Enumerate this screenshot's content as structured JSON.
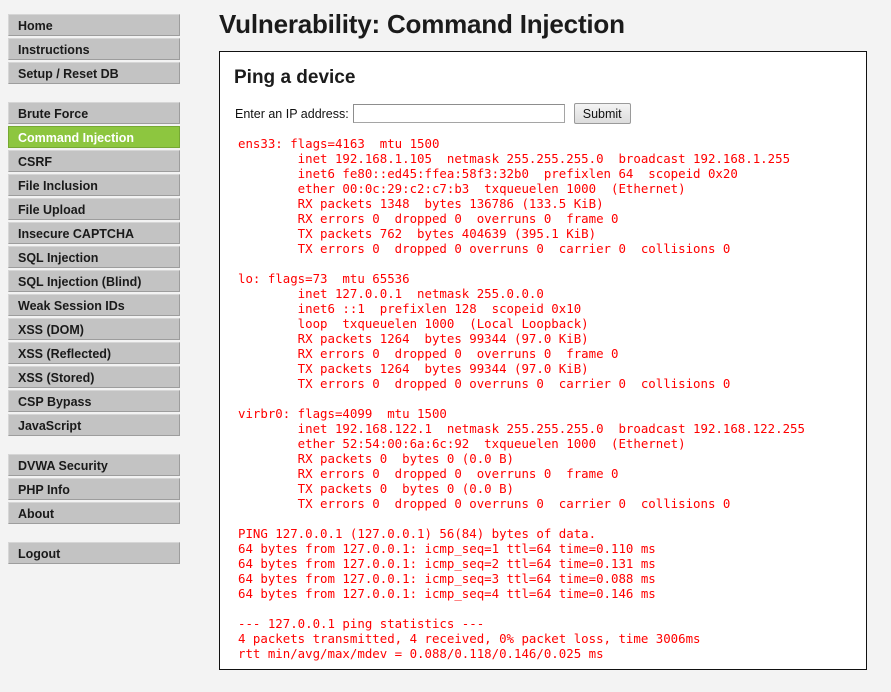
{
  "page": {
    "title": "Vulnerability: Command Injection",
    "accent_green": "#8dc63f",
    "output_red": "#ff0000",
    "sidebar_button_bg": "#c3c3c3",
    "background": "#f3f3f3"
  },
  "sidebar": {
    "groups": [
      {
        "name": "primary",
        "items": [
          {
            "label": "Home",
            "selected": false
          },
          {
            "label": "Instructions",
            "selected": false
          },
          {
            "label": "Setup / Reset DB",
            "selected": false
          }
        ]
      },
      {
        "name": "vulnerabilities",
        "items": [
          {
            "label": "Brute Force",
            "selected": false
          },
          {
            "label": "Command Injection",
            "selected": true
          },
          {
            "label": "CSRF",
            "selected": false
          },
          {
            "label": "File Inclusion",
            "selected": false
          },
          {
            "label": "File Upload",
            "selected": false
          },
          {
            "label": "Insecure CAPTCHA",
            "selected": false
          },
          {
            "label": "SQL Injection",
            "selected": false
          },
          {
            "label": "SQL Injection (Blind)",
            "selected": false
          },
          {
            "label": "Weak Session IDs",
            "selected": false
          },
          {
            "label": "XSS (DOM)",
            "selected": false
          },
          {
            "label": "XSS (Reflected)",
            "selected": false
          },
          {
            "label": "XSS (Stored)",
            "selected": false
          },
          {
            "label": "CSP Bypass",
            "selected": false
          },
          {
            "label": "JavaScript",
            "selected": false
          }
        ]
      },
      {
        "name": "meta",
        "items": [
          {
            "label": "DVWA Security",
            "selected": false
          },
          {
            "label": "PHP Info",
            "selected": false
          },
          {
            "label": "About",
            "selected": false
          }
        ]
      },
      {
        "name": "session",
        "items": [
          {
            "label": "Logout",
            "selected": false
          }
        ]
      }
    ]
  },
  "panel": {
    "title": "Ping a device",
    "form": {
      "label": "Enter an IP address:",
      "input_value": "",
      "input_placeholder": "",
      "submit_label": "Submit"
    },
    "output": "ens33: flags=4163  mtu 1500\n        inet 192.168.1.105  netmask 255.255.255.0  broadcast 192.168.1.255\n        inet6 fe80::ed45:ffea:58f3:32b0  prefixlen 64  scopeid 0x20\n        ether 00:0c:29:c2:c7:b3  txqueuelen 1000  (Ethernet)\n        RX packets 1348  bytes 136786 (133.5 KiB)\n        RX errors 0  dropped 0  overruns 0  frame 0\n        TX packets 762  bytes 404639 (395.1 KiB)\n        TX errors 0  dropped 0 overruns 0  carrier 0  collisions 0\n\nlo: flags=73  mtu 65536\n        inet 127.0.0.1  netmask 255.0.0.0\n        inet6 ::1  prefixlen 128  scopeid 0x10\n        loop  txqueuelen 1000  (Local Loopback)\n        RX packets 1264  bytes 99344 (97.0 KiB)\n        RX errors 0  dropped 0  overruns 0  frame 0\n        TX packets 1264  bytes 99344 (97.0 KiB)\n        TX errors 0  dropped 0 overruns 0  carrier 0  collisions 0\n\nvirbr0: flags=4099  mtu 1500\n        inet 192.168.122.1  netmask 255.255.255.0  broadcast 192.168.122.255\n        ether 52:54:00:6a:6c:92  txqueuelen 1000  (Ethernet)\n        RX packets 0  bytes 0 (0.0 B)\n        RX errors 0  dropped 0  overruns 0  frame 0\n        TX packets 0  bytes 0 (0.0 B)\n        TX errors 0  dropped 0 overruns 0  carrier 0  collisions 0\n\nPING 127.0.0.1 (127.0.0.1) 56(84) bytes of data.\n64 bytes from 127.0.0.1: icmp_seq=1 ttl=64 time=0.110 ms\n64 bytes from 127.0.0.1: icmp_seq=2 ttl=64 time=0.131 ms\n64 bytes from 127.0.0.1: icmp_seq=3 ttl=64 time=0.088 ms\n64 bytes from 127.0.0.1: icmp_seq=4 ttl=64 time=0.146 ms\n\n--- 127.0.0.1 ping statistics ---\n4 packets transmitted, 4 received, 0% packet loss, time 3006ms\nrtt min/avg/max/mdev = 0.088/0.118/0.146/0.025 ms",
    "output_details": {
      "interfaces": [
        {
          "name": "ens33",
          "flags": "4163",
          "mtu": "1500",
          "inet": "192.168.1.105",
          "netmask": "255.255.255.0",
          "broadcast": "192.168.1.255",
          "inet6": "fe80::ed45:ffea:58f3:32b0",
          "prefixlen": "64",
          "scopeid": "0x20",
          "ether": "00:0c:29:c2:c7:b3",
          "txqueuelen": "1000",
          "type": "Ethernet",
          "rx_packets": "1348",
          "rx_bytes": "136786 (133.5 KiB)",
          "rx_errors": "0",
          "rx_dropped": "0",
          "rx_overruns": "0",
          "rx_frame": "0",
          "tx_packets": "762",
          "tx_bytes": "404639 (395.1 KiB)",
          "tx_errors": "0",
          "tx_dropped": "0",
          "tx_overruns": "0",
          "tx_carrier": "0",
          "tx_collisions": "0"
        },
        {
          "name": "lo",
          "flags": "73",
          "mtu": "65536",
          "inet": "127.0.0.1",
          "netmask": "255.0.0.0",
          "inet6": "::1",
          "prefixlen": "128",
          "scopeid": "0x10",
          "txqueuelen": "1000",
          "type": "Local Loopback",
          "rx_packets": "1264",
          "rx_bytes": "99344 (97.0 KiB)",
          "rx_errors": "0",
          "rx_dropped": "0",
          "rx_overruns": "0",
          "rx_frame": "0",
          "tx_packets": "1264",
          "tx_bytes": "99344 (97.0 KiB)",
          "tx_errors": "0",
          "tx_dropped": "0",
          "tx_overruns": "0",
          "tx_carrier": "0",
          "tx_collisions": "0"
        },
        {
          "name": "virbr0",
          "flags": "4099",
          "mtu": "1500",
          "inet": "192.168.122.1",
          "netmask": "255.255.255.0",
          "broadcast": "192.168.122.255",
          "ether": "52:54:00:6a:6c:92",
          "txqueuelen": "1000",
          "type": "Ethernet",
          "rx_packets": "0",
          "rx_bytes": "0 (0.0 B)",
          "rx_errors": "0",
          "rx_dropped": "0",
          "rx_overruns": "0",
          "rx_frame": "0",
          "tx_packets": "0",
          "tx_bytes": "0 (0.0 B)",
          "tx_errors": "0",
          "tx_dropped": "0",
          "tx_overruns": "0",
          "tx_carrier": "0",
          "tx_collisions": "0"
        }
      ],
      "ping": {
        "header": "PING 127.0.0.1 (127.0.0.1) 56(84) bytes of data.",
        "replies": [
          {
            "bytes": "64",
            "from": "127.0.0.1",
            "icmp_seq": "1",
            "ttl": "64",
            "time": "0.110 ms"
          },
          {
            "bytes": "64",
            "from": "127.0.0.1",
            "icmp_seq": "2",
            "ttl": "64",
            "time": "0.131 ms"
          },
          {
            "bytes": "64",
            "from": "127.0.0.1",
            "icmp_seq": "3",
            "ttl": "64",
            "time": "0.088 ms"
          },
          {
            "bytes": "64",
            "from": "127.0.0.1",
            "icmp_seq": "4",
            "ttl": "64",
            "time": "0.146 ms"
          }
        ],
        "statistics_header": "--- 127.0.0.1 ping statistics ---",
        "transmitted": "4",
        "received": "4",
        "packet_loss": "0%",
        "total_time": "3006ms",
        "rtt_label": "rtt min/avg/max/mdev",
        "rtt_values": "0.088/0.118/0.146/0.025 ms"
      }
    }
  }
}
